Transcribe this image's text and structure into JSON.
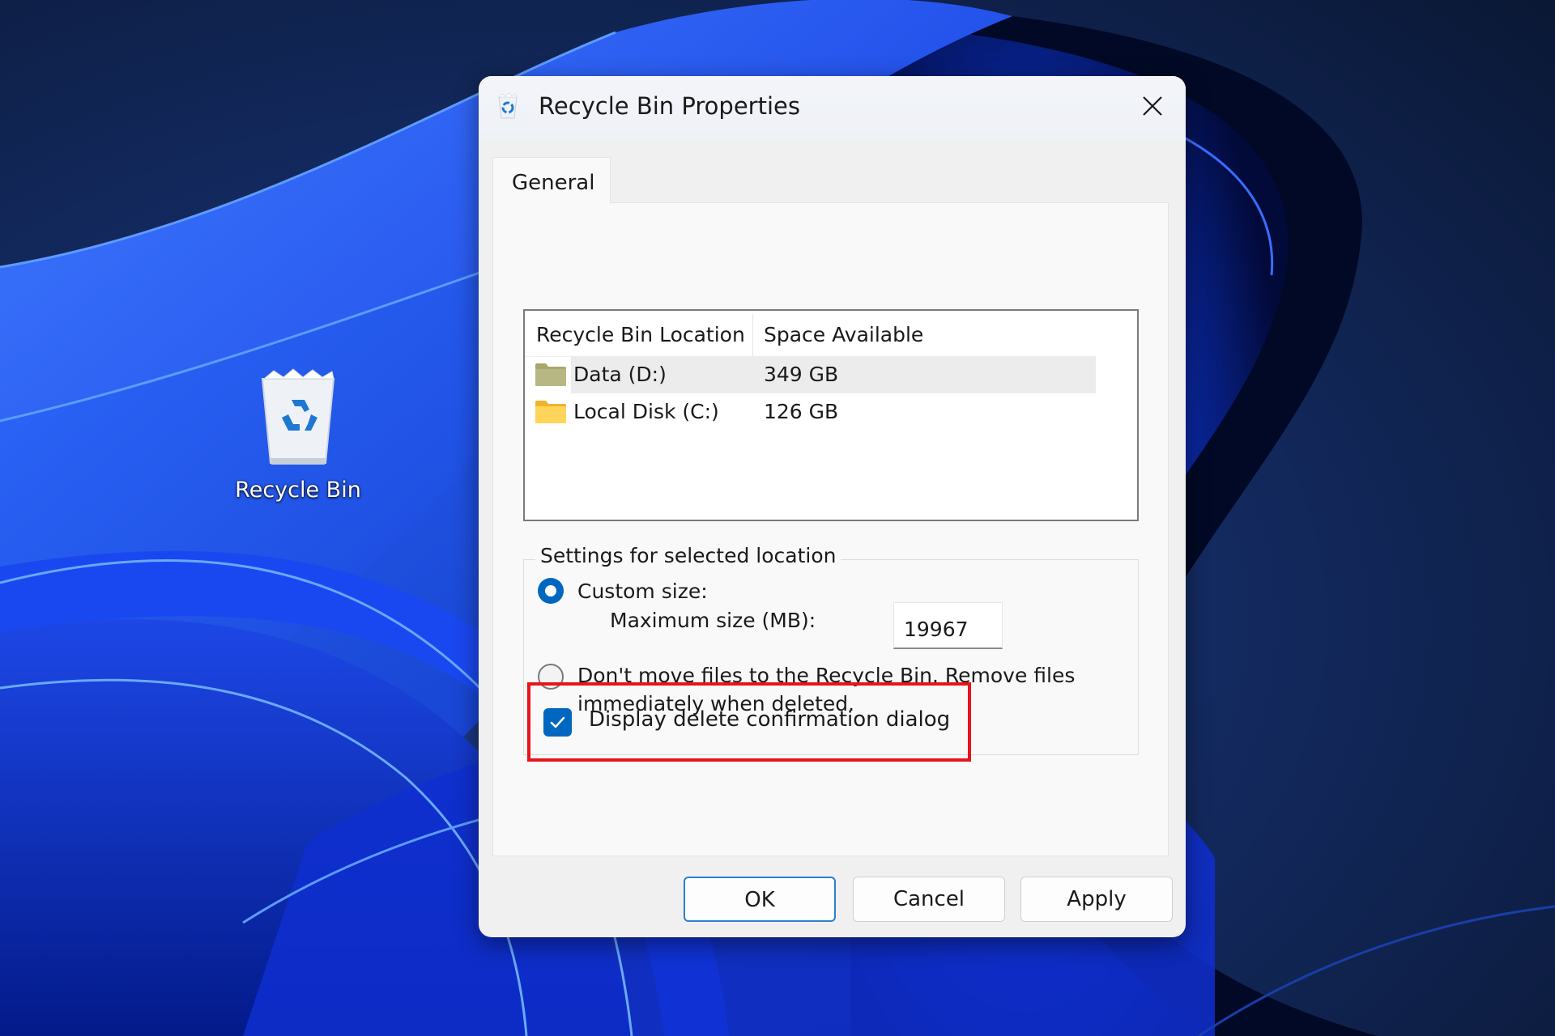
{
  "desktop": {
    "icons": [
      {
        "label": "Recycle Bin",
        "icon": "recycle-bin-icon"
      }
    ]
  },
  "dialog": {
    "title": "Recycle Bin Properties",
    "title_icon": "recycle-bin-icon",
    "close_icon": "close-icon",
    "tabs": [
      {
        "label": "General",
        "active": true
      }
    ],
    "locations": {
      "columns": [
        "Recycle Bin Location",
        "Space Available"
      ],
      "rows": [
        {
          "name": "Data (D:)",
          "space": "349 GB",
          "selected": true,
          "icon": "folder-icon"
        },
        {
          "name": "Local Disk (C:)",
          "space": "126 GB",
          "selected": false,
          "icon": "folder-icon"
        }
      ]
    },
    "settings": {
      "legend": "Settings for selected location",
      "custom_size_label": "Custom size:",
      "custom_size_selected": true,
      "max_size_label": "Maximum size (MB):",
      "max_size_value": "19967",
      "dont_move_label_line1": "Don't move files to the Recycle Bin. Remove files",
      "dont_move_label_line2": "immediately when deleted.",
      "dont_move_selected": false
    },
    "confirm_checkbox": {
      "label": "Display delete confirmation dialog",
      "checked": true,
      "annotation_color": "#e8141b"
    },
    "buttons": {
      "ok": "OK",
      "cancel": "Cancel",
      "apply": "Apply"
    },
    "accent_color": "#0067c0"
  }
}
